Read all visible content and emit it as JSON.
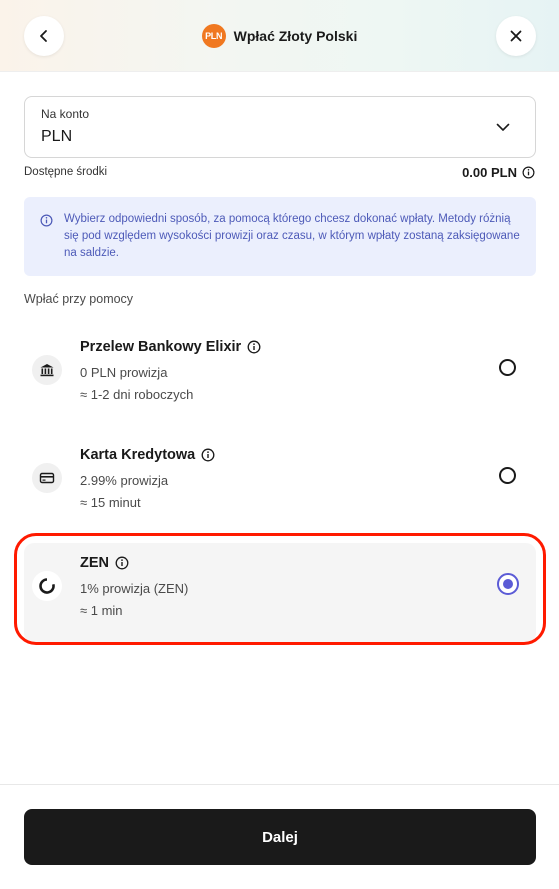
{
  "header": {
    "title": "Wpłać Złoty Polski",
    "currency_badge": "PLN",
    "back_icon": "chevron-left-icon",
    "close_icon": "close-icon"
  },
  "account": {
    "label": "Na konto",
    "value": "PLN"
  },
  "available": {
    "label": "Dostępne środki",
    "value": "0.00 PLN"
  },
  "info": {
    "text": "Wybierz odpowiedni sposób, za pomocą którego chcesz dokonać wpłaty. Metody różnią się pod względem wysokości prowizji oraz czasu, w którym wpłaty zostaną zaksięgowane na saldzie."
  },
  "section_label": "Wpłać przy pomocy",
  "methods": [
    {
      "title": "Przelew Bankowy Elixir",
      "fee": "0 PLN prowizja",
      "time": "≈ 1-2 dni roboczych",
      "icon": "bank-icon",
      "selected": false
    },
    {
      "title": "Karta Kredytowa",
      "fee": "2.99% prowizja",
      "time": "≈ 15 minut",
      "icon": "credit-card-icon",
      "selected": false
    },
    {
      "title": "ZEN",
      "fee": "1% prowizja (ZEN)",
      "time": "≈ 1 min",
      "icon": "zen-logo-icon",
      "selected": true
    }
  ],
  "next_button": "Dalej",
  "colors": {
    "accent": "#5b5bd6",
    "badge": "#f07820",
    "info_text": "#4d5ab8",
    "info_bg": "#ebeffd",
    "highlight": "#ff1a00",
    "button_bg": "#1a1a1a"
  }
}
